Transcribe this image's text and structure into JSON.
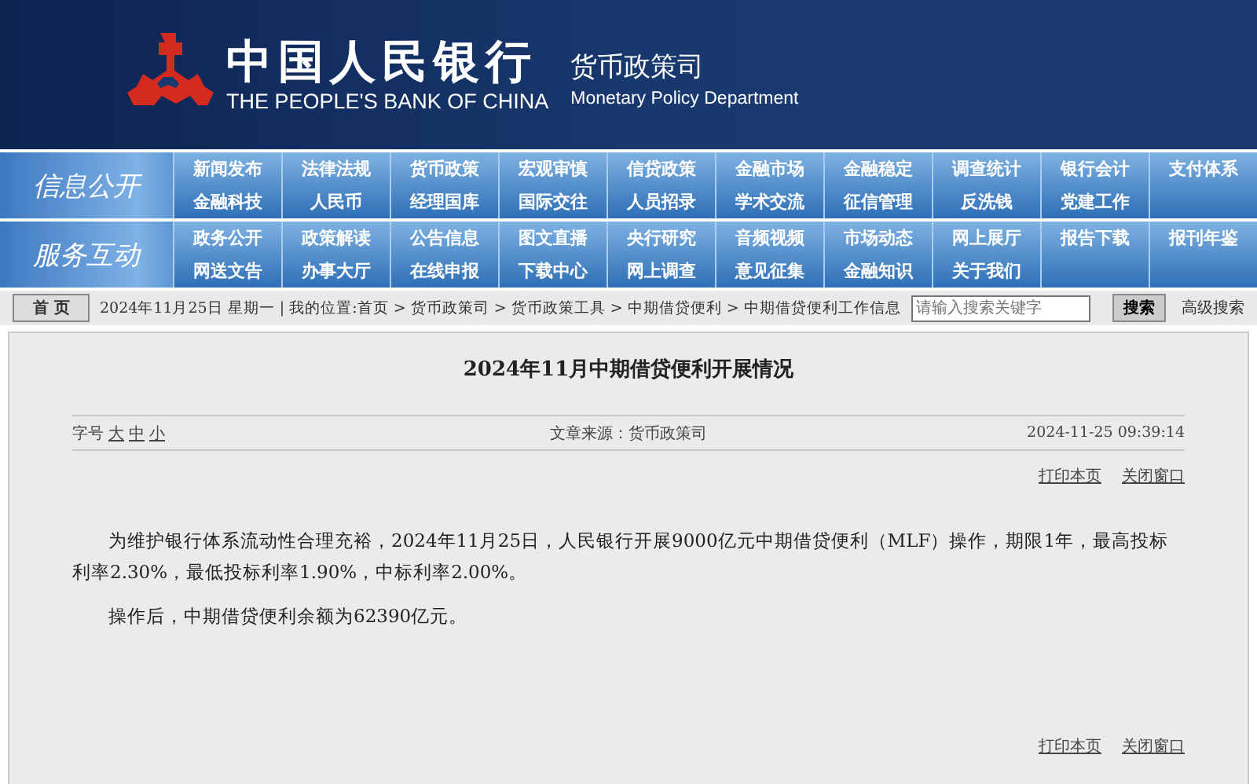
{
  "header": {
    "title_cn": "中国人民银行",
    "title_en": "THE PEOPLE'S BANK OF CHINA",
    "dept_cn": "货币政策司",
    "dept_en": "Monetary Policy Department"
  },
  "nav": [
    {
      "label": "信息公开",
      "rows": [
        [
          "新闻发布",
          "法律法规",
          "货币政策",
          "宏观审慎",
          "信贷政策",
          "金融市场",
          "金融稳定",
          "调查统计",
          "银行会计",
          "支付体系"
        ],
        [
          "金融科技",
          "人民币",
          "经理国库",
          "国际交往",
          "人员招录",
          "学术交流",
          "征信管理",
          "反洗钱",
          "党建工作"
        ]
      ]
    },
    {
      "label": "服务互动",
      "rows": [
        [
          "政务公开",
          "政策解读",
          "公告信息",
          "图文直播",
          "央行研究",
          "音频视频",
          "市场动态",
          "网上展厅",
          "报告下载",
          "报刊年鉴"
        ],
        [
          "网送文告",
          "办事大厅",
          "在线申报",
          "下载中心",
          "网上调查",
          "意见征集",
          "金融知识",
          "关于我们"
        ]
      ]
    }
  ],
  "breadcrumb": {
    "home_button": "首 页",
    "text": "2024年11月25日 星期一 | 我的位置:首页 > 货币政策司 > 货币政策工具 > 中期借贷便利 > 中期借贷便利工作信息",
    "search": {
      "placeholder": "请输入搜索关键字"
    },
    "search_button": "搜索",
    "advanced_search": "高级搜索"
  },
  "article": {
    "title": "2024年11月中期借贷便利开展情况",
    "font_size_label": "字号",
    "font_sizes": [
      "大",
      "中",
      "小"
    ],
    "source": "文章来源：货币政策司",
    "timestamp": "2024-11-25 09:39:14",
    "top_actions": [
      "打印本页",
      "关闭窗口"
    ],
    "paragraphs": [
      "为维护银行体系流动性合理充裕，2024年11月25日，人民银行开展9000亿元中期借贷便利（MLF）操作，期限1年，最高投标利率2.30%，最低投标利率1.90%，中标利率2.00%。",
      "操作后，中期借贷便利余额为62390亿元。"
    ],
    "bottom_actions": [
      "打印本页",
      "关闭窗口"
    ]
  }
}
